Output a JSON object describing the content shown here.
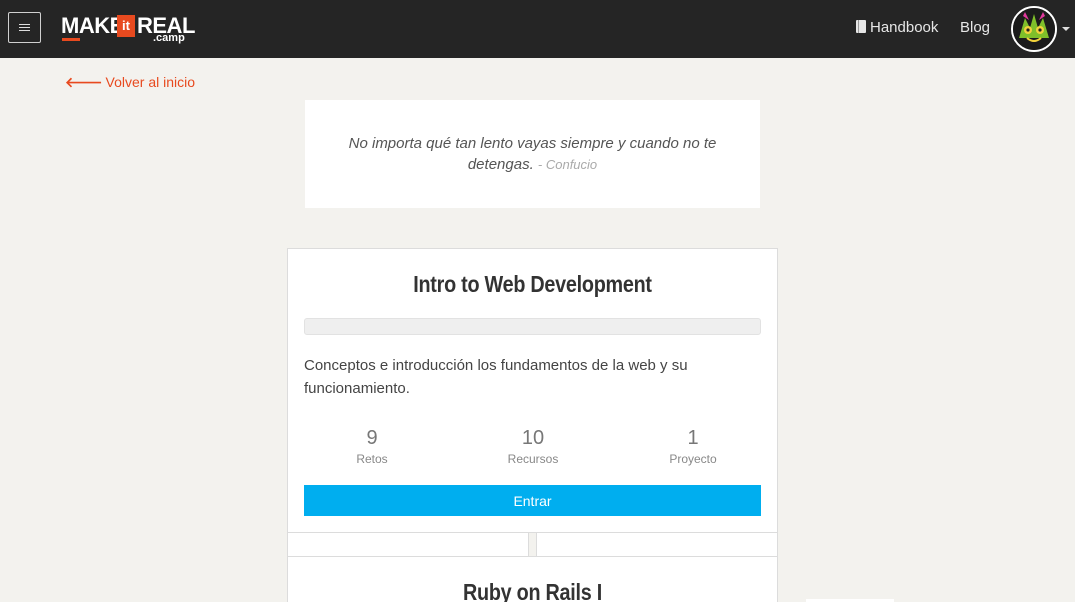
{
  "nav": {
    "logo": {
      "make": "MAKE",
      "it": "it",
      "real": "REAL",
      "camp": ".camp"
    },
    "handbook_label": "Handbook",
    "blog_label": "Blog",
    "menu_icon": "hamburger-icon",
    "handbook_icon": "book-icon",
    "avatar_icon": "avatar"
  },
  "back_link": {
    "label": "Volver al inicio",
    "icon": "arrow-left-icon"
  },
  "quote": {
    "text": "No importa qué tan lento vayas siempre y cuando no te detengas.",
    "author": "- Confucio"
  },
  "courses": [
    {
      "title": "Intro to Web Development",
      "progress_percent": 0,
      "description": "Conceptos e introducción los fundamentos de la web y su funcionamiento.",
      "stats": [
        {
          "value": "9",
          "label": "Retos"
        },
        {
          "value": "10",
          "label": "Recursos"
        },
        {
          "value": "1",
          "label": "Proyecto"
        }
      ],
      "button_label": "Entrar"
    },
    {
      "title": "Ruby on Rails I"
    }
  ],
  "colors": {
    "navbar": "#252525",
    "accent_orange": "#e84a1f",
    "accent_blue": "#00aeef",
    "background": "#f3f2ee"
  }
}
